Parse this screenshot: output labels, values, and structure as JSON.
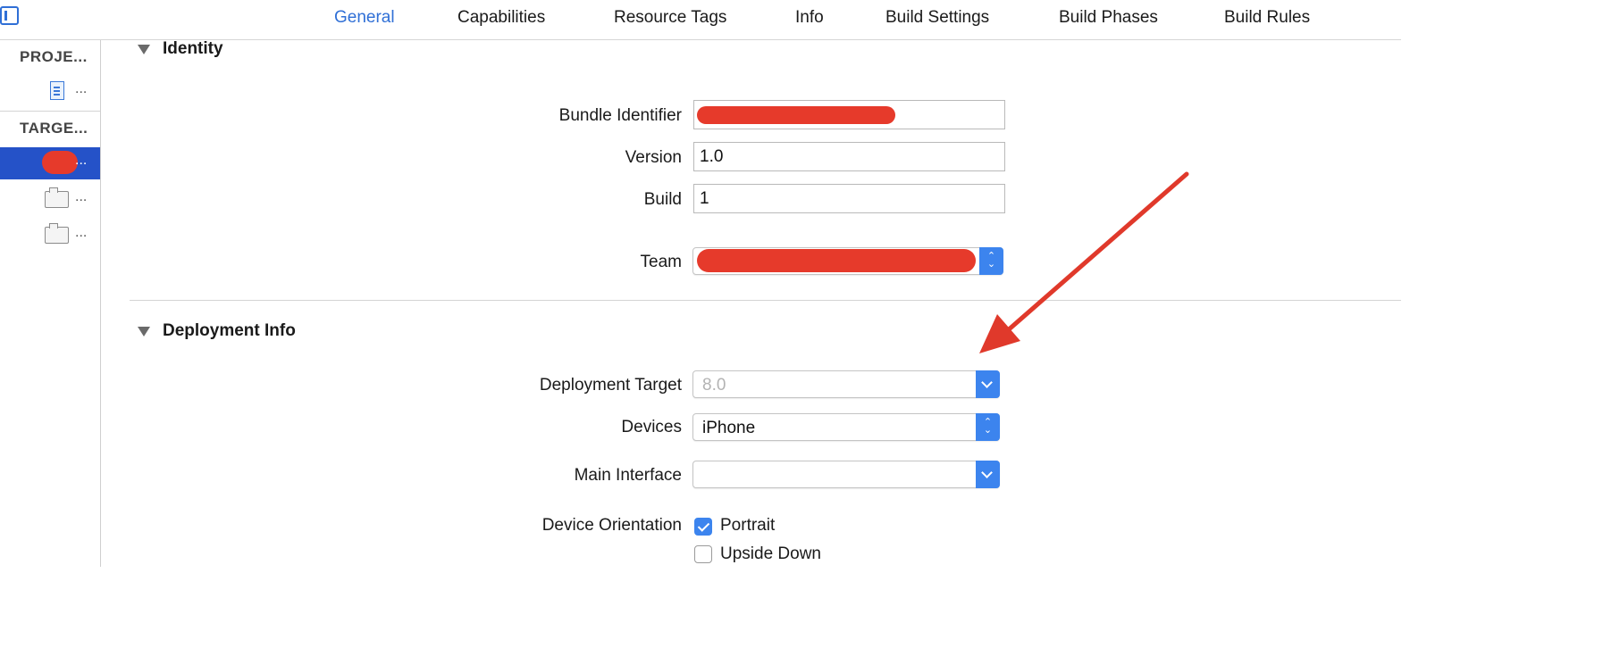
{
  "tabs": [
    "General",
    "Capabilities",
    "Resource Tags",
    "Info",
    "Build Settings",
    "Build Phases",
    "Build Rules"
  ],
  "active_tab": "General",
  "sidebar": {
    "project_header": "PROJE...",
    "targets_header": "TARGE...",
    "ellipsis": "..."
  },
  "identity": {
    "title": "Identity",
    "bundle_identifier_label": "Bundle Identifier",
    "version_label": "Version",
    "version_value": "1.0",
    "build_label": "Build",
    "build_value": "1",
    "team_label": "Team"
  },
  "deployment": {
    "title": "Deployment Info",
    "deployment_target_label": "Deployment Target",
    "deployment_target_value": "8.0",
    "devices_label": "Devices",
    "devices_value": "iPhone",
    "main_interface_label": "Main Interface",
    "main_interface_value": "",
    "device_orientation_label": "Device Orientation",
    "orientations": [
      {
        "label": "Portrait",
        "checked": true
      },
      {
        "label": "Upside Down",
        "checked": false
      }
    ]
  },
  "colors": {
    "accent": "#3c84ee",
    "selection": "#2552c8",
    "redaction": "#e63a2b",
    "annotation_arrow": "#e0392b"
  }
}
